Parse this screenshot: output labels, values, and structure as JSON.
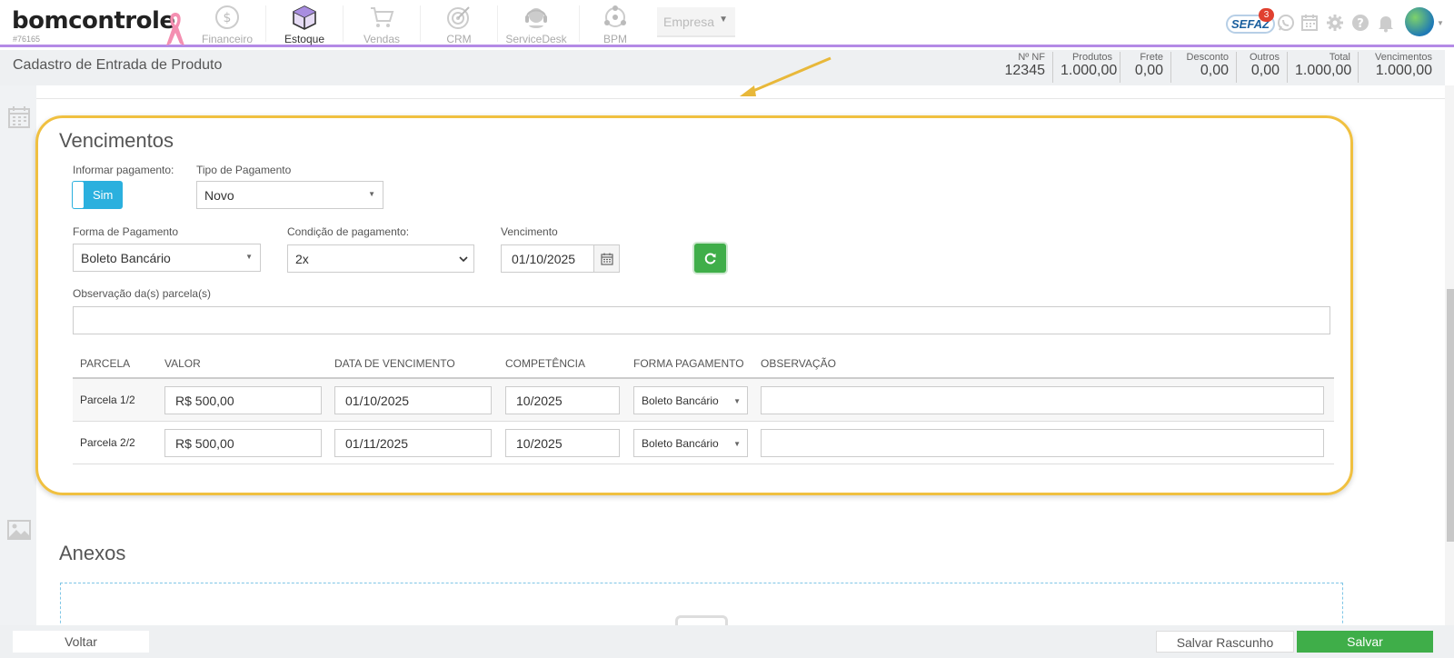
{
  "app": {
    "logo_text": "bomcontrole",
    "account_id": "#76165"
  },
  "nav": [
    {
      "label": "Financeiro",
      "icon": "dollar-icon"
    },
    {
      "label": "Estoque",
      "icon": "box-icon",
      "active": true
    },
    {
      "label": "Vendas",
      "icon": "cart-icon"
    },
    {
      "label": "CRM",
      "icon": "target-icon"
    },
    {
      "label": "ServiceDesk",
      "icon": "headset-icon"
    },
    {
      "label": "BPM",
      "icon": "network-icon"
    }
  ],
  "company_select": {
    "label": "Empresa"
  },
  "topright": {
    "sefaz_label": "SEFAZ",
    "sefaz_badge": "3",
    "icons": [
      "whatsapp-icon",
      "calendar-icon",
      "gear-icon",
      "help-icon",
      "bell-icon",
      "avatar"
    ]
  },
  "page": {
    "title": "Cadastro de Entrada de Produto"
  },
  "summary": [
    {
      "label": "Nº NF",
      "value": "12345"
    },
    {
      "label": "Produtos",
      "value": "1.000,00"
    },
    {
      "label": "Frete",
      "value": "0,00"
    },
    {
      "label": "Desconto",
      "value": "0,00"
    },
    {
      "label": "Outros",
      "value": "0,00"
    },
    {
      "label": "Total",
      "value": "1.000,00"
    },
    {
      "label": "Vencimentos",
      "value": "1.000,00"
    }
  ],
  "vencimentos": {
    "section_title": "Vencimentos",
    "informar_label": "Informar pagamento:",
    "informar_value": "Sim",
    "tipo_label": "Tipo de Pagamento",
    "tipo_value": "Novo",
    "forma_label": "Forma de Pagamento",
    "forma_value": "Boleto Bancário",
    "condicao_label": "Condição de pagamento:",
    "condicao_value": "2x",
    "vencimento_label": "Vencimento",
    "vencimento_value": "01/10/2025",
    "obs_label": "Observação da(s) parcela(s)",
    "obs_value": ""
  },
  "table": {
    "headers": [
      "PARCELA",
      "VALOR",
      "DATA DE VENCIMENTO",
      "COMPETÊNCIA",
      "FORMA PAGAMENTO",
      "OBSERVAÇÃO"
    ],
    "rows": [
      {
        "parcela": "Parcela 1/2",
        "valor": "R$ 500,00",
        "data": "01/10/2025",
        "competencia": "10/2025",
        "forma": "Boleto Bancário",
        "obs": ""
      },
      {
        "parcela": "Parcela 2/2",
        "valor": "R$ 500,00",
        "data": "01/11/2025",
        "competencia": "10/2025",
        "forma": "Boleto Bancário",
        "obs": ""
      }
    ]
  },
  "anexos": {
    "section_title": "Anexos"
  },
  "footer": {
    "voltar": "Voltar",
    "rascunho": "Salvar Rascunho",
    "salvar": "Salvar"
  },
  "colors": {
    "accent_purple": "#b48ae6",
    "primary_blue": "#2bb0de",
    "success_green": "#3fae49",
    "highlight_yellow": "#f0c040"
  }
}
